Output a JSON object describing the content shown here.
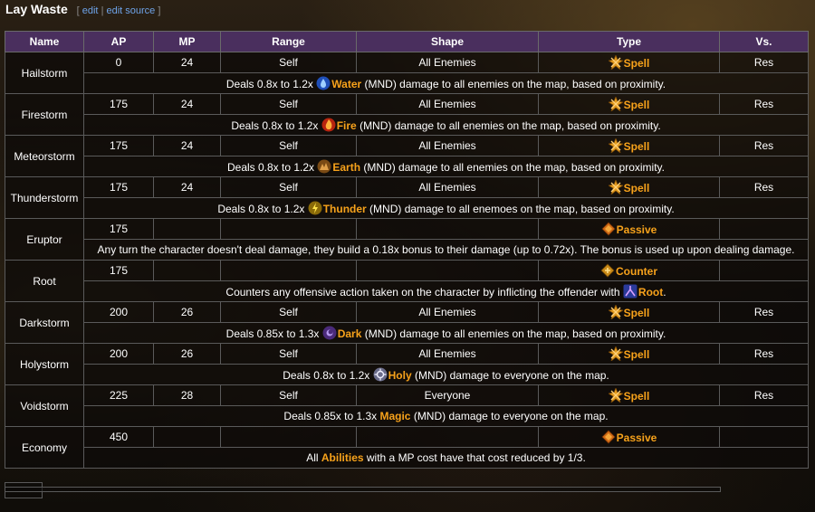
{
  "page": {
    "title": "Lay Waste",
    "edit_open": "[",
    "edit_label": "edit",
    "edit_sep": "|",
    "edit_source_label": "edit source",
    "edit_close": "]"
  },
  "table": {
    "headers": [
      "Name",
      "AP",
      "MP",
      "Range",
      "Shape",
      "Type",
      "Vs."
    ],
    "rows": [
      {
        "name": "Hailstorm",
        "ap": "0",
        "mp": "24",
        "range": "Self",
        "shape": "All Enemies",
        "type": "Spell",
        "vs": "Res",
        "desc_pre": "Deals 0.8x to 1.2x ",
        "desc_key": "Water",
        "desc_post": " (MND) damage to all enemies on the map, based on proximity."
      },
      {
        "name": "Firestorm",
        "ap": "175",
        "mp": "24",
        "range": "Self",
        "shape": "All Enemies",
        "type": "Spell",
        "vs": "Res",
        "desc_pre": "Deals 0.8x to 1.2x ",
        "desc_key": "Fire",
        "desc_post": " (MND) damage to all enemies on the map, based on proximity."
      },
      {
        "name": "Meteorstorm",
        "ap": "175",
        "mp": "24",
        "range": "Self",
        "shape": "All Enemies",
        "type": "Spell",
        "vs": "Res",
        "desc_pre": "Deals 0.8x to 1.2x ",
        "desc_key": "Earth",
        "desc_post": " (MND) damage to all enemies on the map, based on proximity."
      },
      {
        "name": "Thunderstorm",
        "ap": "175",
        "mp": "24",
        "range": "Self",
        "shape": "All Enemies",
        "type": "Spell",
        "vs": "Res",
        "desc_pre": "Deals 0.8x to 1.2x ",
        "desc_key": "Thunder",
        "desc_post": " (MND) damage to all enemoes on the map, based on proximity."
      },
      {
        "name": "Eruptor",
        "ap": "175",
        "mp": "",
        "range": "",
        "shape": "",
        "type": "Passive",
        "vs": "",
        "desc_pre": "Any turn the character doesn't deal damage, they build a 0.18x bonus to their damage (up to 0.72x). The bonus is used up upon dealing damage.",
        "desc_key": "",
        "desc_post": ""
      },
      {
        "name": "Root",
        "ap": "175",
        "mp": "",
        "range": "",
        "shape": "",
        "type": "Counter",
        "vs": "",
        "desc_pre": "Counters any offensive action taken on the character by inflicting the offender with ",
        "desc_key": "Root",
        "desc_post": "."
      },
      {
        "name": "Darkstorm",
        "ap": "200",
        "mp": "26",
        "range": "Self",
        "shape": "All Enemies",
        "type": "Spell",
        "vs": "Res",
        "desc_pre": "Deals 0.85x to 1.3x ",
        "desc_key": "Dark",
        "desc_post": " (MND) damage to all enemies on the map, based on proximity."
      },
      {
        "name": "Holystorm",
        "ap": "200",
        "mp": "26",
        "range": "Self",
        "shape": "All Enemies",
        "type": "Spell",
        "vs": "Res",
        "desc_pre": "Deals 0.8x to 1.2x ",
        "desc_key": "Holy",
        "desc_post": " (MND) damage to everyone on the map."
      },
      {
        "name": "Voidstorm",
        "ap": "225",
        "mp": "28",
        "range": "Self",
        "shape": "Everyone",
        "type": "Spell",
        "vs": "Res",
        "desc_pre": "Deals 0.85x to 1.3x ",
        "desc_key": "Magic",
        "desc_post": " (MND) damage to everyone on the map."
      },
      {
        "name": "Economy",
        "ap": "450",
        "mp": "",
        "range": "",
        "shape": "",
        "type": "Passive",
        "vs": "",
        "desc_pre": "All ",
        "desc_key": "Abilities",
        "desc_post": " with a MP cost have that cost reduced by 1/3."
      }
    ]
  },
  "icons": {
    "spell": "spell-icon",
    "passive": "passive-icon",
    "counter": "counter-icon",
    "water": "water-element-icon",
    "fire": "fire-element-icon",
    "earth": "earth-element-icon",
    "thunder": "thunder-element-icon",
    "dark": "dark-element-icon",
    "holy": "holy-element-icon",
    "root": "root-status-icon"
  },
  "colors": {
    "header_bg": "#4a2f5e",
    "accent": "#f7a21b",
    "link": "#6ea3e8"
  }
}
